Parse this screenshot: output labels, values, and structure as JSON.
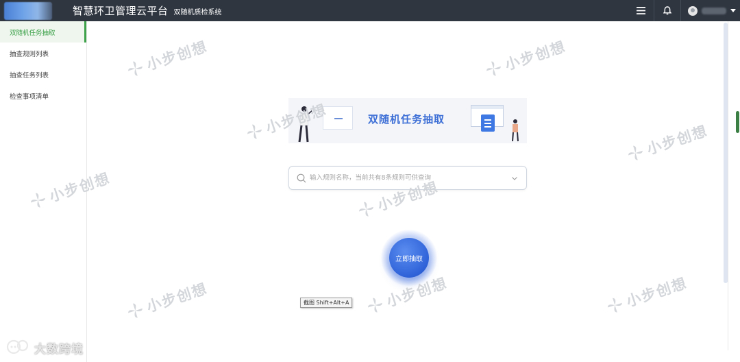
{
  "header": {
    "title": "智慧环卫管理云平台",
    "subtitle": "双随机质检系统"
  },
  "sidebar": {
    "items": [
      {
        "label": "双随机任务抽取",
        "active": true
      },
      {
        "label": "抽查规则列表",
        "active": false
      },
      {
        "label": "抽查任务列表",
        "active": false
      },
      {
        "label": "检查事项清单",
        "active": false
      }
    ]
  },
  "banner": {
    "title": "双随机任务抽取"
  },
  "search": {
    "placeholder": "输入规则名称，当前共有8条规则可供查询"
  },
  "draw_button": {
    "label": "立即抽取"
  },
  "tooltip": {
    "text": "截图 Shift+Alt+A"
  },
  "watermark": {
    "text": "小步创想"
  },
  "corner_badge": {
    "text": "大数跨境"
  },
  "colors": {
    "header_bg": "#2f3640",
    "accent_green": "#3ea24a",
    "primary_blue": "#2f62d8",
    "banner_title": "#3d6fd6"
  }
}
